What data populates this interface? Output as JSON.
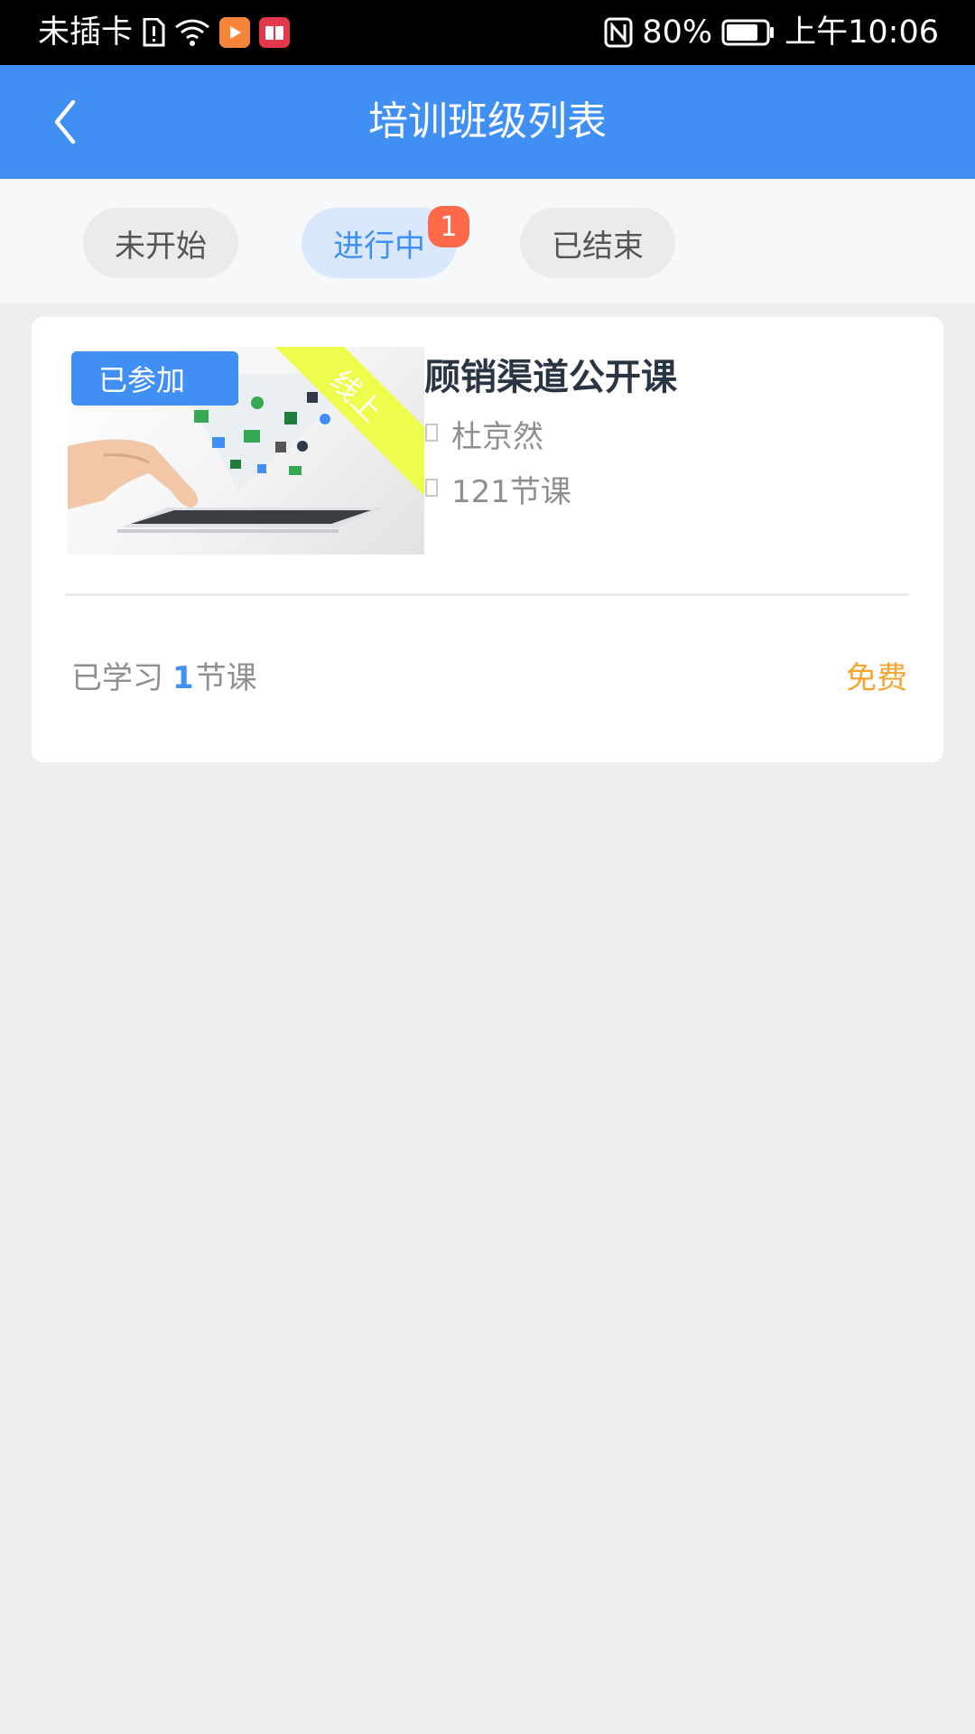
{
  "status_bar": {
    "carrier": "未插卡",
    "battery_percent": "80%",
    "time": "上午10:06",
    "icons": [
      "sim-alert-icon",
      "wifi-icon",
      "video-app-icon",
      "book-app-icon",
      "nfc-icon",
      "battery-icon"
    ],
    "battery_level": 0.8
  },
  "header": {
    "title": "培训班级列表",
    "back_icon": "chevron-left-icon"
  },
  "tabs": [
    {
      "label": "未开始",
      "active": false
    },
    {
      "label": "进行中",
      "active": true,
      "badge": "1"
    },
    {
      "label": "已结束",
      "active": false
    }
  ],
  "course": {
    "joined_badge": "已参加",
    "mode_ribbon": "线上",
    "title": "顾销渠道公开课",
    "teacher": "杜京然",
    "lessons": "121节课",
    "progress_prefix": "已学习",
    "progress_count": "1",
    "progress_suffix": "节课",
    "price": "免费"
  },
  "colors": {
    "primary": "#3f8ff5",
    "badge": "#ff6b4a",
    "price": "#f7a531",
    "ribbon": "#eefc4b"
  }
}
